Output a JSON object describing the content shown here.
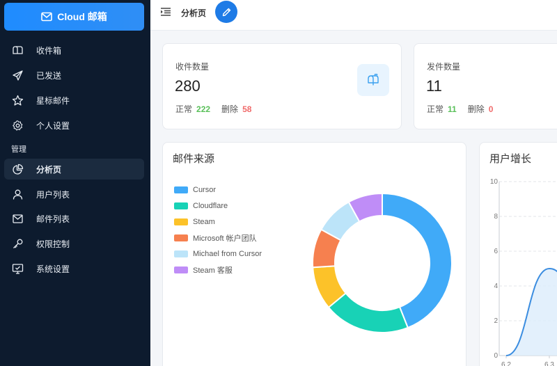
{
  "brand": {
    "label": "Cloud 邮箱",
    "icon": "mail-icon"
  },
  "sidebar": {
    "items": [
      {
        "label": "收件箱",
        "icon": "inbox-icon"
      },
      {
        "label": "已发送",
        "icon": "send-icon"
      },
      {
        "label": "星标邮件",
        "icon": "star-icon"
      },
      {
        "label": "个人设置",
        "icon": "gear-icon"
      }
    ],
    "group_label": "管理",
    "admin_items": [
      {
        "label": "分析页",
        "icon": "pie-chart-icon",
        "active": true
      },
      {
        "label": "用户列表",
        "icon": "user-icon"
      },
      {
        "label": "邮件列表",
        "icon": "mail-list-icon"
      },
      {
        "label": "权限控制",
        "icon": "key-icon"
      },
      {
        "label": "系统设置",
        "icon": "monitor-icon"
      }
    ]
  },
  "topbar": {
    "page_name": "分析页",
    "edit_icon": "pencil-icon",
    "toggle_icon": "menu-indent-icon"
  },
  "stats": {
    "received": {
      "title": "收件数量",
      "value": "280",
      "normal_label": "正常",
      "normal_value": "222",
      "deleted_label": "删除",
      "deleted_value": "58",
      "icon": "mailbox-icon"
    },
    "sent": {
      "title": "发件数量",
      "value": "11",
      "normal_label": "正常",
      "normal_value": "11",
      "deleted_label": "删除",
      "deleted_value": "0"
    }
  },
  "colors": {
    "accent": "#1e7be6",
    "ok": "#5ac05a",
    "del": "#f06a6a",
    "line": "#3b8de0"
  },
  "chart_data": [
    {
      "type": "pie",
      "title": "邮件来源",
      "legend_position": "left",
      "categories": [
        "Cursor",
        "Cloudflare",
        "Steam",
        "Microsoft 帐户团队",
        "Michael from Cursor",
        "Steam 客服"
      ],
      "values": [
        44,
        20,
        10,
        9,
        9,
        8
      ],
      "colors": [
        "#40aaf8",
        "#18d2b6",
        "#fcc229",
        "#f6804f",
        "#bce4f9",
        "#bf8df7"
      ]
    },
    {
      "type": "area",
      "title": "用户增长",
      "categories": [
        "6.2",
        "6.3"
      ],
      "x": [
        0,
        1,
        1.4
      ],
      "values": [
        0,
        5,
        4.6
      ],
      "ylim": [
        0,
        10
      ],
      "yticks": [
        0,
        2,
        4,
        6,
        8,
        10
      ],
      "grid": true
    }
  ]
}
